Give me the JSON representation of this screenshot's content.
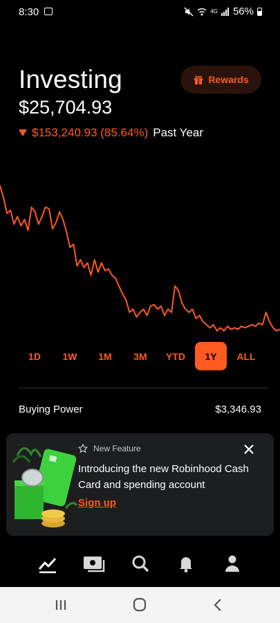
{
  "status_bar": {
    "time": "8:30",
    "network": "4G",
    "battery": "56%"
  },
  "header": {
    "title": "Investing",
    "balance": "$25,704.93",
    "change_amount": "$153,240.93 (85.64%)",
    "change_period": "Past Year",
    "rewards_label": "Rewards"
  },
  "colors": {
    "accent": "#ff5a1f",
    "background": "#000000",
    "card": "#1d1e20",
    "rewards_bg": "#2a130c"
  },
  "chart_data": {
    "type": "line",
    "title": "",
    "xlabel": "",
    "ylabel": "",
    "grid": false,
    "series": [
      {
        "values": [
          100,
          92,
          82,
          84,
          75,
          80,
          74,
          78,
          71,
          86,
          83,
          75,
          80,
          86,
          85,
          72,
          76,
          83,
          78,
          70,
          60,
          62,
          48,
          52,
          47,
          50,
          42,
          52,
          44,
          50,
          45,
          46,
          42,
          40,
          35,
          30,
          26,
          18,
          20,
          15,
          18,
          20,
          16,
          22,
          23,
          20,
          22,
          16,
          20,
          18,
          35,
          32,
          24,
          20,
          18,
          20,
          14,
          16,
          12,
          10,
          8,
          10,
          6,
          8,
          6,
          9,
          7,
          8,
          7,
          9,
          8,
          9,
          10,
          9,
          11,
          10,
          18,
          12,
          8,
          6,
          7
        ]
      }
    ]
  },
  "ranges": [
    {
      "label": "1D"
    },
    {
      "label": "1W"
    },
    {
      "label": "1M"
    },
    {
      "label": "3M"
    },
    {
      "label": "YTD"
    },
    {
      "label": "1Y",
      "active": true
    },
    {
      "label": "ALL"
    }
  ],
  "buying_power": {
    "label": "Buying Power",
    "value": "$3,346.93"
  },
  "promo": {
    "badge": "New Feature",
    "headline": "Introducing the new Robinhood Cash Card and spending account",
    "cta": "Sign up"
  },
  "bottom_nav": {
    "items": [
      {
        "name": "investing-chart-icon",
        "active": true
      },
      {
        "name": "cash-card-icon"
      },
      {
        "name": "search-icon"
      },
      {
        "name": "notifications-bell-icon"
      },
      {
        "name": "account-person-icon"
      }
    ]
  }
}
